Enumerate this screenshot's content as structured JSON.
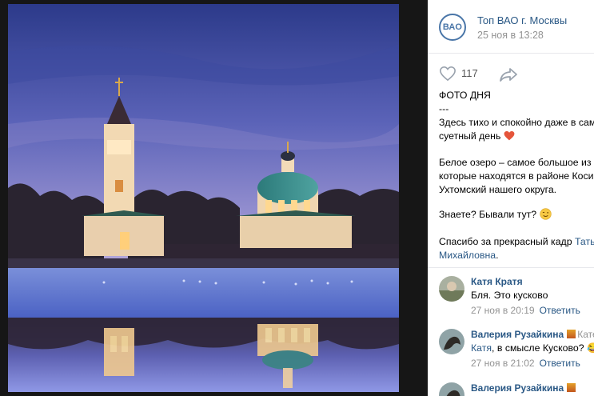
{
  "group": {
    "name": "Топ ВАО г. Москвы",
    "avatar_text": "ВАО",
    "date": "25 ноя в 13:28"
  },
  "actions": {
    "like_icon": "heart-outline-icon",
    "like_count": "117",
    "share_icon": "share-arrow-icon"
  },
  "post": {
    "line1": "ФОТО ДНЯ",
    "line2": "---",
    "line3": "Здесь тихо и спокойно даже в сам",
    "line4": "суетный день",
    "line5": "Белое озеро – самое большое из",
    "line6": "которые находятся в районе Коси",
    "line7": "Ухтомский нашего округа.",
    "line8": "Знаете? Бывали тут?",
    "line9_text": "Спасибо за прекрасный кадр ",
    "line9_link": "Тать",
    "line10_link": "Михайловна",
    "line10_end": "."
  },
  "comments": [
    {
      "author": "Катя Кратя",
      "text": "Бля. Это кусково",
      "date": "27 ноя в 20:19",
      "reply": "Ответить"
    },
    {
      "author": "Валерия Рузайкина",
      "reply_to": "Кате",
      "mention": "Катя",
      "text": ", в смысле Кусково? 😂",
      "date": "27 ноя в 21:02",
      "reply": "Ответить"
    },
    {
      "author": "Валерия Рузайкина"
    }
  ],
  "colors": {
    "link": "#2a5885",
    "meta": "#939393",
    "sky_top": "#2f3f8f",
    "sky_bottom": "#a39cd6"
  }
}
